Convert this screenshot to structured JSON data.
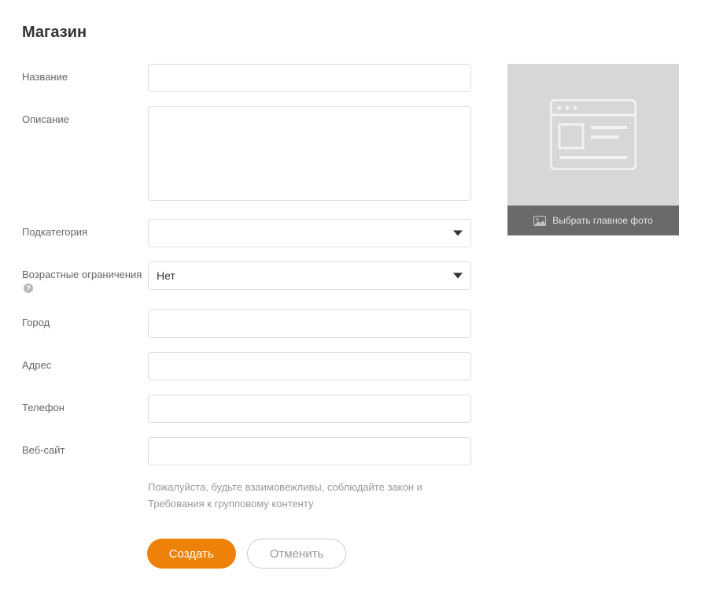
{
  "page": {
    "title": "Магазин"
  },
  "form": {
    "name": {
      "label": "Название",
      "value": ""
    },
    "description": {
      "label": "Описание",
      "value": ""
    },
    "subcategory": {
      "label": "Подкатегория",
      "selected": ""
    },
    "age_restriction": {
      "label": "Возрастные ограничения",
      "selected": "Нет"
    },
    "city": {
      "label": "Город",
      "value": ""
    },
    "address": {
      "label": "Адрес",
      "value": ""
    },
    "phone": {
      "label": "Телефон",
      "value": ""
    },
    "website": {
      "label": "Веб-сайт",
      "value": ""
    }
  },
  "disclaimer": {
    "prefix": "Пожалуйста, будьте взаимовежливы, соблюдайте закон и ",
    "link": "Требования к групповому контенту"
  },
  "buttons": {
    "create": "Создать",
    "cancel": "Отменить"
  },
  "photo": {
    "choose_label": "Выбрать главное фото"
  },
  "icons": {
    "help": "?"
  }
}
